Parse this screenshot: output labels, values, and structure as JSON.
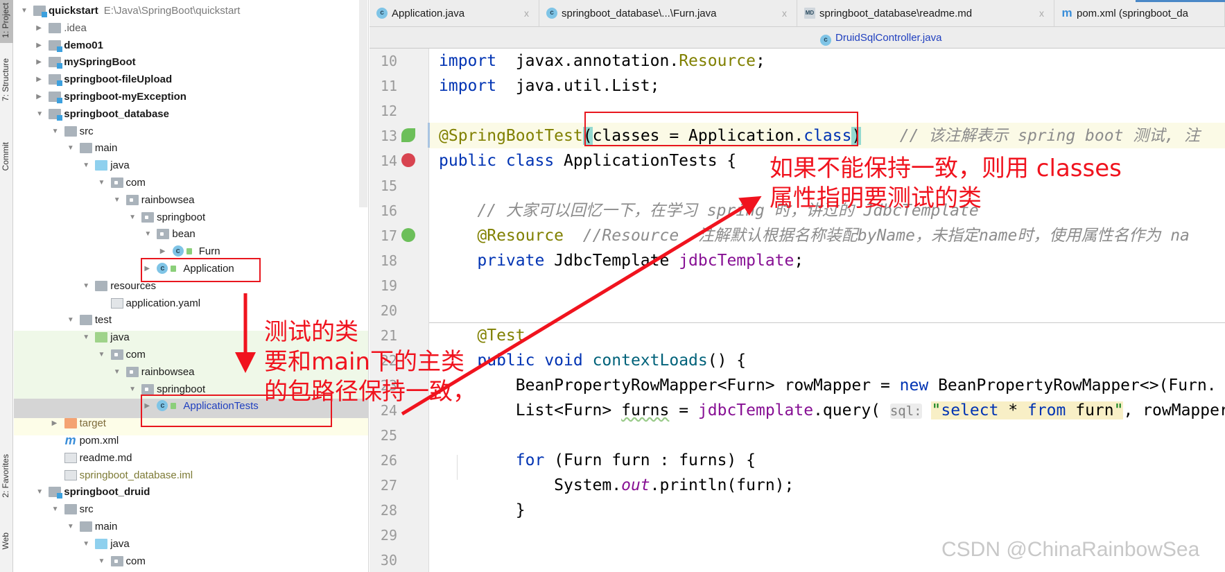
{
  "side_strip": {
    "items": [
      "1: Project",
      "7: Structure",
      "Commit",
      "2: Favorites",
      "Web"
    ]
  },
  "tree": {
    "items": [
      {
        "depth": 0,
        "label": "quickstart",
        "path": "E:\\Java\\SpringBoot\\quickstart",
        "bold": true,
        "state": "open",
        "icon": "module-folder-icon"
      },
      {
        "depth": 1,
        "label": ".idea",
        "state": "closed",
        "icon": "folder-icon",
        "color": "#555555"
      },
      {
        "depth": 1,
        "label": "demo01",
        "bold": true,
        "state": "closed",
        "icon": "module-folder-icon"
      },
      {
        "depth": 1,
        "label": "mySpringBoot",
        "bold": true,
        "state": "closed",
        "icon": "module-folder-icon"
      },
      {
        "depth": 1,
        "label": "springboot-fileUpload",
        "bold": true,
        "state": "closed",
        "icon": "module-folder-icon"
      },
      {
        "depth": 1,
        "label": "springboot-myException",
        "bold": true,
        "state": "closed",
        "icon": "module-folder-icon"
      },
      {
        "depth": 1,
        "label": "springboot_database",
        "bold": true,
        "state": "open",
        "icon": "module-folder-icon"
      },
      {
        "depth": 2,
        "label": "src",
        "state": "open",
        "icon": "folder-icon"
      },
      {
        "depth": 3,
        "label": "main",
        "state": "open",
        "icon": "folder-icon"
      },
      {
        "depth": 4,
        "label": "java",
        "state": "open",
        "icon": "source-folder-icon"
      },
      {
        "depth": 5,
        "label": "com",
        "state": "open",
        "icon": "package-icon"
      },
      {
        "depth": 6,
        "label": "rainbowsea",
        "state": "open",
        "icon": "package-icon"
      },
      {
        "depth": 7,
        "label": "springboot",
        "state": "open",
        "icon": "package-icon"
      },
      {
        "depth": 8,
        "label": "bean",
        "state": "open",
        "icon": "package-icon"
      },
      {
        "depth": 9,
        "label": "Furn",
        "state": "closed",
        "icon": "class-icon"
      },
      {
        "depth": 8,
        "label": "Application",
        "state": "closed",
        "icon": "spring-boot-class-icon"
      },
      {
        "depth": 4,
        "label": "resources",
        "state": "open",
        "icon": "resources-folder-icon"
      },
      {
        "depth": 5,
        "label": "application.yaml",
        "state": "leaf",
        "icon": "yaml-file-icon"
      },
      {
        "depth": 3,
        "label": "test",
        "state": "open",
        "icon": "folder-icon"
      },
      {
        "depth": 4,
        "label": "java",
        "state": "open",
        "icon": "test-folder-icon"
      },
      {
        "depth": 5,
        "label": "com",
        "state": "open",
        "icon": "package-icon"
      },
      {
        "depth": 6,
        "label": "rainbowsea",
        "state": "open",
        "icon": "package-icon"
      },
      {
        "depth": 7,
        "label": "springboot",
        "state": "open",
        "icon": "package-icon"
      },
      {
        "depth": 8,
        "label": "ApplicationTests",
        "state": "closed",
        "icon": "test-class-icon",
        "color": "#1f3fbf",
        "selected": true
      },
      {
        "depth": 2,
        "label": "target",
        "state": "closed",
        "icon": "excluded-folder-icon",
        "color": "#7d6a3a"
      },
      {
        "depth": 2,
        "label": "pom.xml",
        "state": "leaf",
        "icon": "maven-icon"
      },
      {
        "depth": 2,
        "label": "readme.md",
        "state": "leaf",
        "icon": "markdown-icon"
      },
      {
        "depth": 2,
        "label": "springboot_database.iml",
        "state": "leaf",
        "icon": "iml-file-icon",
        "color": "#7d7a35"
      },
      {
        "depth": 1,
        "label": "springboot_druid",
        "bold": true,
        "state": "open",
        "icon": "module-folder-icon"
      },
      {
        "depth": 2,
        "label": "src",
        "state": "open",
        "icon": "folder-icon"
      },
      {
        "depth": 3,
        "label": "main",
        "state": "open",
        "icon": "folder-icon"
      },
      {
        "depth": 4,
        "label": "java",
        "state": "open",
        "icon": "source-folder-icon"
      },
      {
        "depth": 5,
        "label": "com",
        "state": "open",
        "icon": "package-icon"
      }
    ]
  },
  "tabs": [
    {
      "label": "Application.java",
      "icon": "spring-boot-class-icon",
      "close": "x"
    },
    {
      "label": "springboot_database\\...\\Furn.java",
      "icon": "class-icon",
      "close": "x"
    },
    {
      "label": "springboot_database\\readme.md",
      "icon": "markdown-icon",
      "close": "x"
    },
    {
      "label": "pom.xml (springboot_da",
      "icon": "maven-icon",
      "active": true
    }
  ],
  "tab_row2": {
    "label": "DruidSqlController.java",
    "icon": "class-icon"
  },
  "editor": {
    "lines": [
      {
        "n": "10",
        "t": [
          [
            "kw",
            "import"
          ],
          [
            "",
            "  javax.annotation."
          ],
          [
            "an",
            "Resource"
          ],
          [
            "",
            ";"
          ]
        ]
      },
      {
        "n": "11",
        "t": [
          [
            "kw",
            "import"
          ],
          [
            "",
            "  java.util.List;"
          ]
        ]
      },
      {
        "n": "12",
        "t": []
      },
      {
        "n": "13",
        "t": [
          [
            "an",
            "@SpringBootTest"
          ],
          [
            "br",
            "("
          ],
          [
            "",
            "classes = Application."
          ],
          [
            "kw",
            "class"
          ],
          [
            "br",
            ")"
          ],
          [
            "",
            "    "
          ],
          [
            "cm",
            "// 该注解表示 spring boot 测试, 注"
          ]
        ],
        "highlight": true
      },
      {
        "n": "14",
        "t": [
          [
            "kw",
            "public class"
          ],
          [
            "",
            " ApplicationTests {"
          ]
        ]
      },
      {
        "n": "15",
        "t": []
      },
      {
        "n": "16",
        "t": [
          [
            "",
            "    "
          ],
          [
            "cm",
            "// 大家可以回忆一下，在学习 spring 时，讲过的 JdbcTemplate"
          ]
        ]
      },
      {
        "n": "17",
        "t": [
          [
            "",
            "    "
          ],
          [
            "an",
            "@Resource"
          ],
          [
            "",
            "  "
          ],
          [
            "cm",
            "//Resource  注解默认根据名称装配byName，未指定name时，使用属性名作为 na"
          ]
        ]
      },
      {
        "n": "18",
        "t": [
          [
            "",
            "    "
          ],
          [
            "kw",
            "private"
          ],
          [
            "",
            " JdbcTemplate "
          ],
          [
            "fd",
            "jdbcTemplate"
          ],
          [
            "",
            ";"
          ]
        ]
      },
      {
        "n": "19",
        "t": []
      },
      {
        "n": "20",
        "t": []
      },
      {
        "n": "21",
        "t": [
          [
            "",
            "    "
          ],
          [
            "an",
            "@Test"
          ]
        ]
      },
      {
        "n": "22",
        "t": [
          [
            "",
            "    "
          ],
          [
            "kw",
            "public void"
          ],
          [
            "mt",
            " contextLoads"
          ],
          [
            "",
            "() {"
          ]
        ]
      },
      {
        "n": "23",
        "t": [
          [
            "",
            "        BeanPropertyRowMapper<Furn> rowMapper = "
          ],
          [
            "kw",
            "new"
          ],
          [
            "",
            " BeanPropertyRowMapper<>(Furn."
          ]
        ]
      },
      {
        "n": "24",
        "t": [
          [
            "",
            "        List<Furn> "
          ],
          [
            "wavy",
            "furns"
          ],
          [
            "",
            " = "
          ],
          [
            "fd",
            "jdbcTemplate"
          ],
          [
            "",
            ".query( "
          ],
          [
            "hint",
            "sql:"
          ],
          [
            "",
            " "
          ],
          [
            "sqq",
            "\""
          ],
          [
            "sqk",
            "select"
          ],
          [
            "sq",
            " * "
          ],
          [
            "sqk",
            "from"
          ],
          [
            "sq",
            " furn"
          ],
          [
            "sqq",
            "\""
          ],
          [
            "",
            ", rowMapper"
          ]
        ]
      },
      {
        "n": "25",
        "t": []
      },
      {
        "n": "26",
        "t": [
          [
            "",
            "        "
          ],
          [
            "kw",
            "for"
          ],
          [
            "",
            " (Furn furn : furns) {"
          ]
        ]
      },
      {
        "n": "27",
        "t": [
          [
            "",
            "            System."
          ],
          [
            "fi",
            "out"
          ],
          [
            "",
            ".println(furn);"
          ]
        ]
      },
      {
        "n": "28",
        "t": [
          [
            "",
            "        }"
          ]
        ]
      },
      {
        "n": "29",
        "t": []
      },
      {
        "n": "30",
        "t": []
      }
    ]
  },
  "annotations": {
    "right": [
      "如果不能保持一致，则用 classes",
      "属性指明要测试的类"
    ],
    "left": [
      "测试的类",
      "要和main下的主类",
      "的包路径保持一致，"
    ],
    "color": "#f0131e"
  },
  "watermark": "CSDN @ChinaRainbowSea"
}
